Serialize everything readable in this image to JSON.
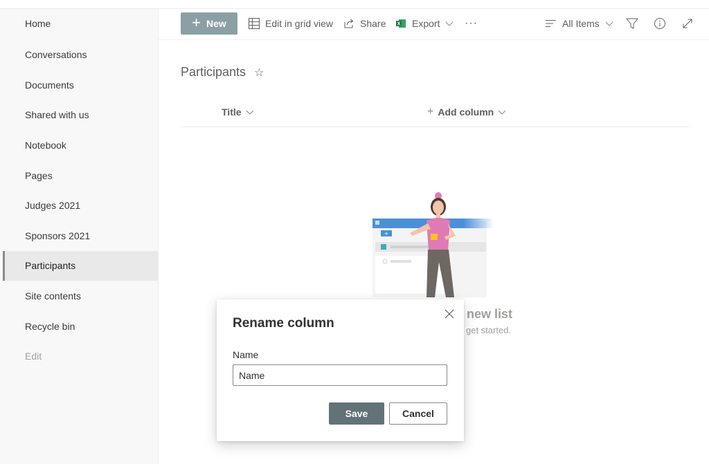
{
  "sidebar": {
    "items": [
      {
        "label": "Home"
      },
      {
        "label": "Conversations"
      },
      {
        "label": "Documents"
      },
      {
        "label": "Shared with us"
      },
      {
        "label": "Notebook"
      },
      {
        "label": "Pages"
      },
      {
        "label": "Judges 2021"
      },
      {
        "label": "Sponsors 2021"
      },
      {
        "label": "Participants",
        "selected": true
      },
      {
        "label": "Site contents"
      },
      {
        "label": "Recycle bin"
      },
      {
        "label": "Edit",
        "disabled": true
      }
    ]
  },
  "commandbar": {
    "new_label": "New",
    "grid_label": "Edit in grid view",
    "share_label": "Share",
    "export_label": "Export",
    "more_label": "···",
    "view_label": "All Items"
  },
  "list": {
    "title": "Participants",
    "columns": {
      "title_label": "Title",
      "add_label": "Add column"
    },
    "empty_title": "new list",
    "empty_sub": "get started."
  },
  "dialog": {
    "title": "Rename column",
    "field_label": "Name",
    "field_value": "Name",
    "save_label": "Save",
    "cancel_label": "Cancel"
  },
  "colors": {
    "new_button": "#8ba0a5",
    "save_button": "#627378",
    "illustration_blue": "#4a90d9",
    "illustration_pink": "#e07ab4",
    "excel_green": "#217346"
  },
  "icons": [
    "plus-icon",
    "grid-view-icon",
    "share-icon",
    "excel-icon",
    "chevron-down-icon",
    "more-icon",
    "view-lines-icon",
    "filter-icon",
    "info-icon",
    "expand-icon",
    "star-icon",
    "close-icon"
  ]
}
